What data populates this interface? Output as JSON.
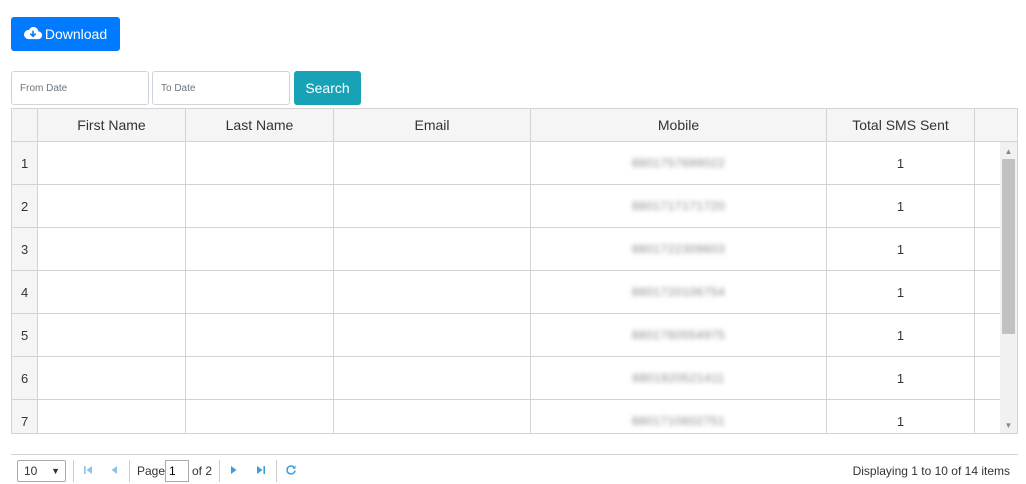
{
  "toolbar": {
    "download_label": "Download",
    "from_date_placeholder": "From Date",
    "to_date_placeholder": "To Date",
    "search_label": "Search"
  },
  "table": {
    "columns": [
      "",
      "First Name",
      "Last Name",
      "Email",
      "Mobile",
      "Total SMS Sent",
      ""
    ],
    "rows": [
      {
        "num": "1",
        "first_name": "",
        "last_name": "",
        "email": "",
        "mobile": "8801757699022",
        "total": "1"
      },
      {
        "num": "2",
        "first_name": "",
        "last_name": "",
        "email": "",
        "mobile": "8801717171720",
        "total": "1"
      },
      {
        "num": "3",
        "first_name": "",
        "last_name": "",
        "email": "",
        "mobile": "8801722309603",
        "total": "1"
      },
      {
        "num": "4",
        "first_name": "",
        "last_name": "",
        "email": "",
        "mobile": "8801720106754",
        "total": "1"
      },
      {
        "num": "5",
        "first_name": "",
        "last_name": "",
        "email": "",
        "mobile": "8801760554975",
        "total": "1"
      },
      {
        "num": "6",
        "first_name": "",
        "last_name": "",
        "email": "",
        "mobile": "8801920521411",
        "total": "1"
      },
      {
        "num": "7",
        "first_name": "",
        "last_name": "",
        "email": "",
        "mobile": "8801710602751",
        "total": "1"
      }
    ]
  },
  "pager": {
    "page_size": "10",
    "page_label": "Page",
    "current_page": "1",
    "of_total": "of 2",
    "display_info": "Displaying 1 to 10 of 14 items"
  },
  "colors": {
    "primary": "#007bff",
    "info": "#17a2b8",
    "pager_icon": "#3c9fd9"
  },
  "icons": {
    "download": "cloud-download-icon",
    "first": "first-page-icon",
    "prev": "prev-page-icon",
    "next": "next-page-icon",
    "last": "last-page-icon",
    "refresh": "refresh-icon"
  }
}
